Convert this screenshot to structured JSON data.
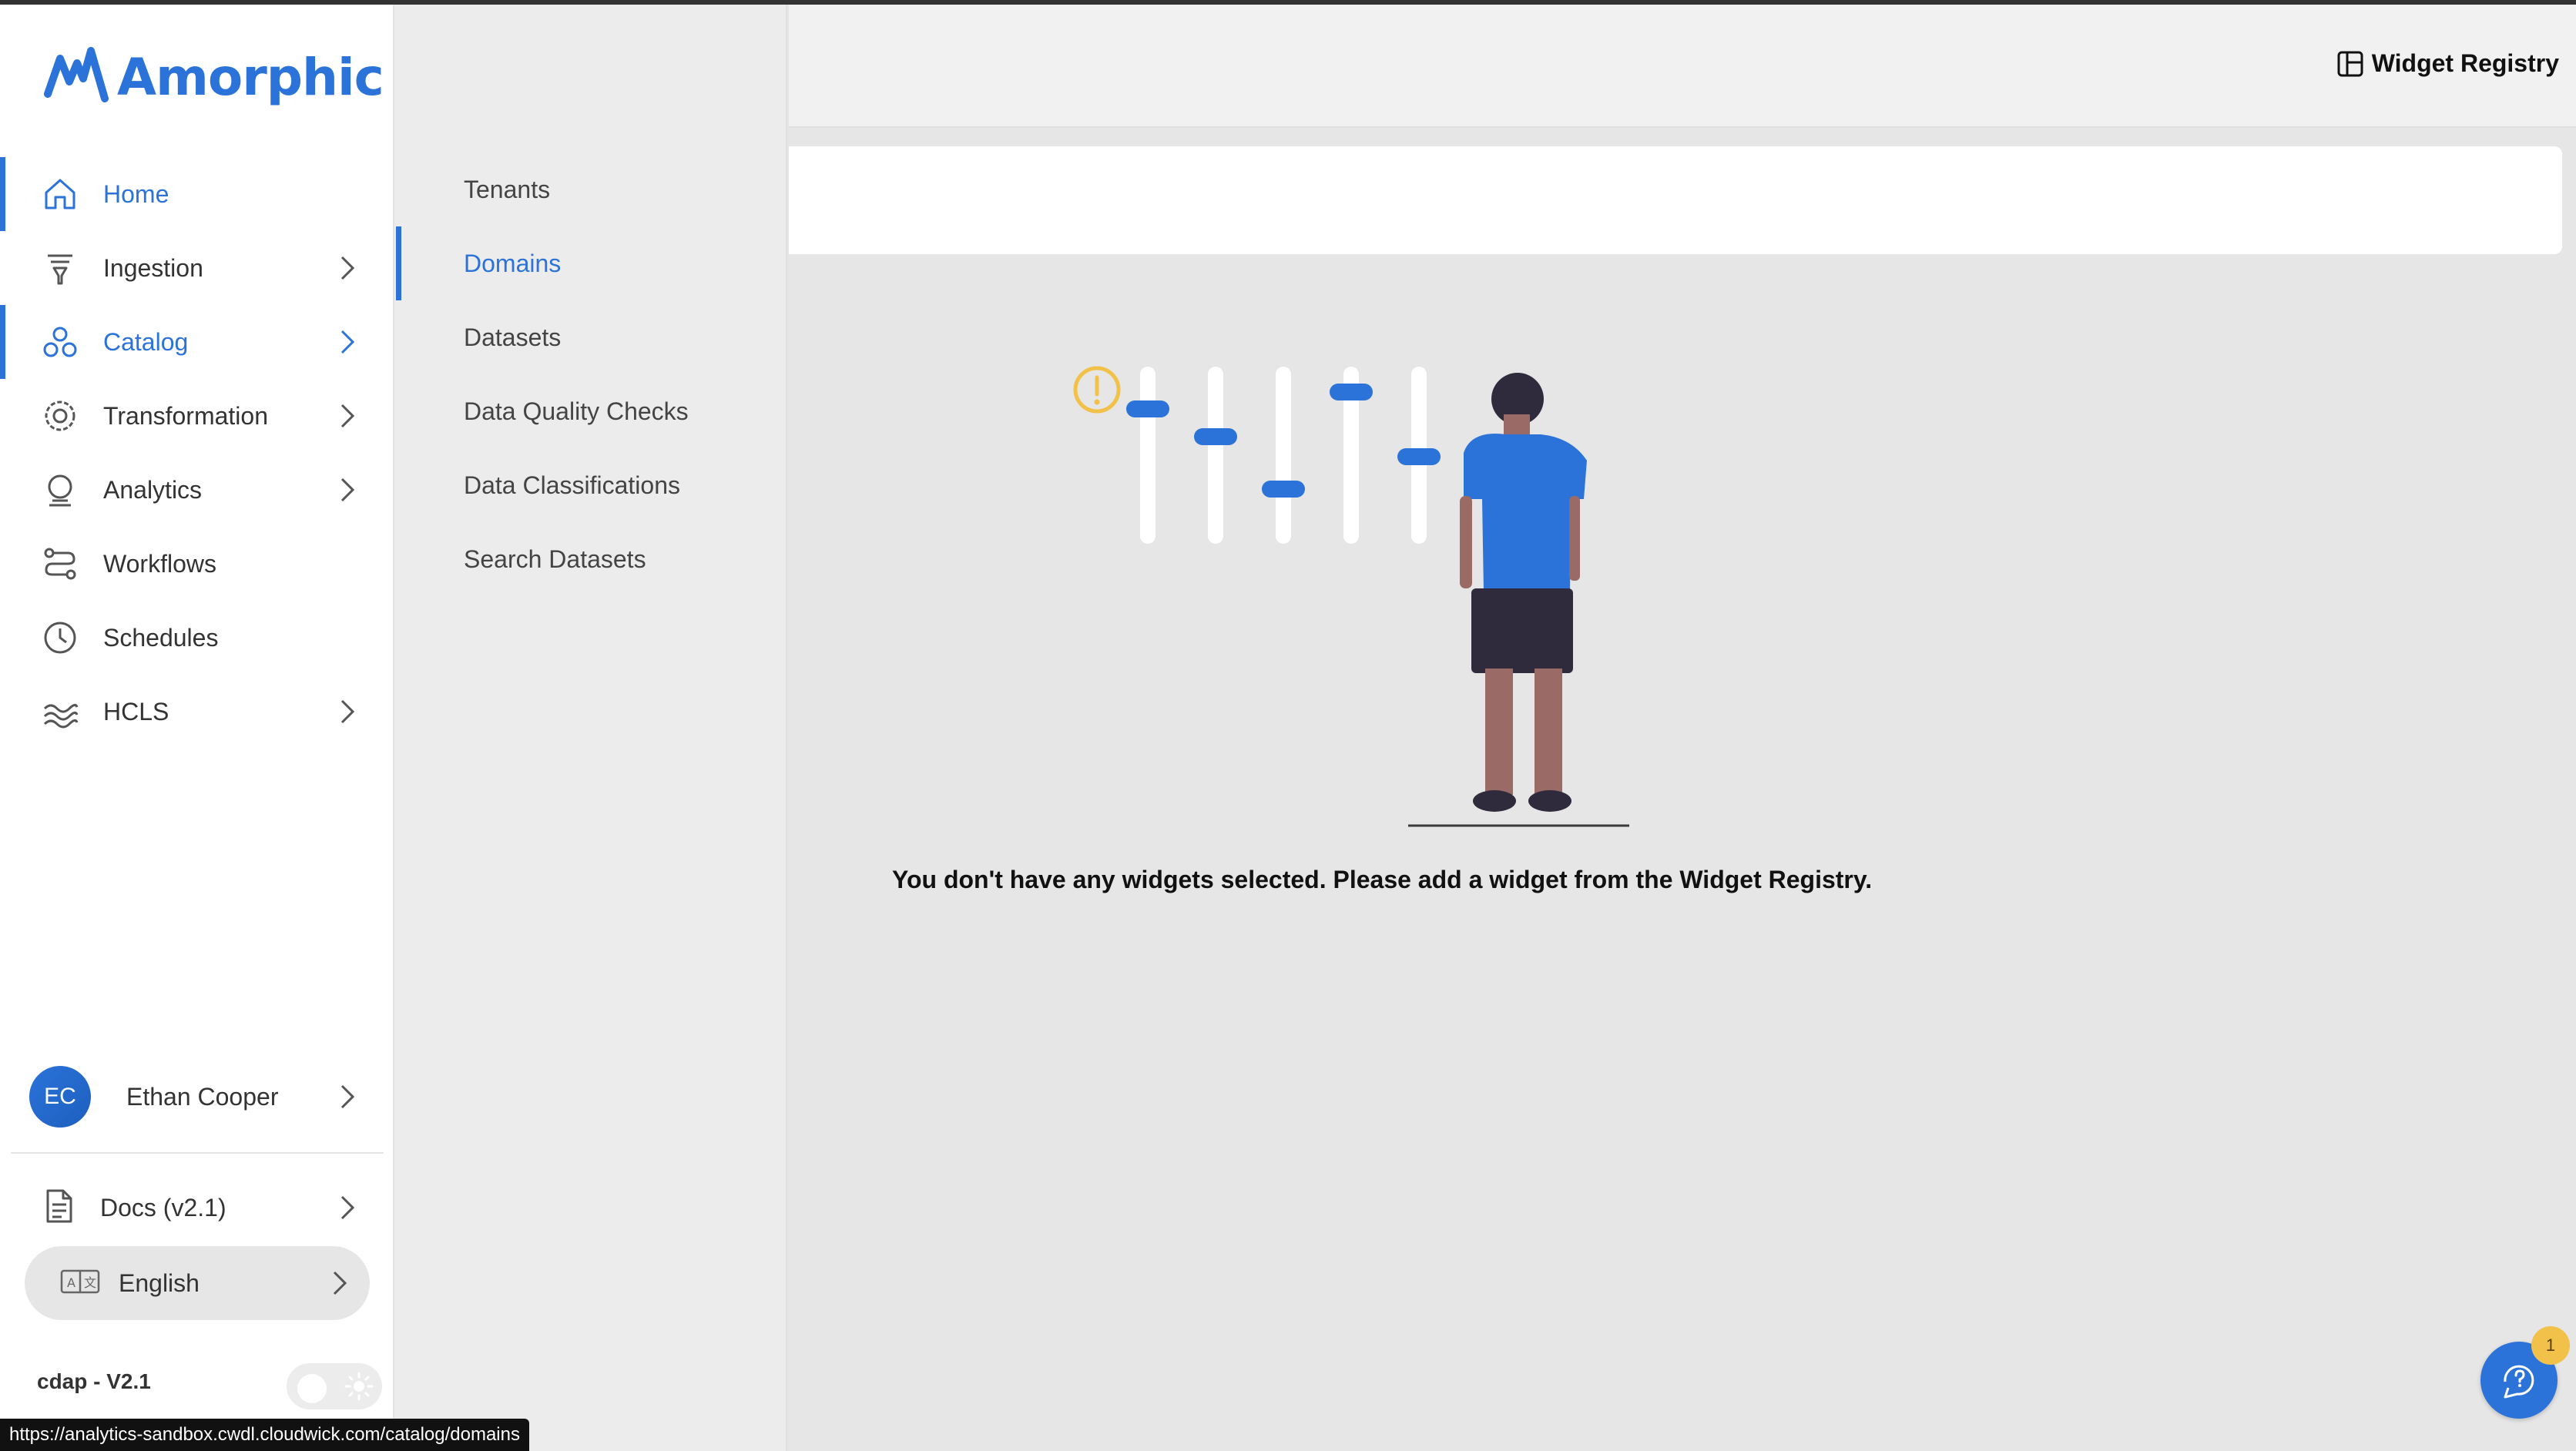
{
  "brand": {
    "name": "Amorphic",
    "color": "#2b73d9"
  },
  "sidebar": {
    "items": [
      {
        "label": "Home",
        "icon": "home-icon",
        "active": true,
        "has_children": false
      },
      {
        "label": "Ingestion",
        "icon": "ingestion-icon",
        "active": false,
        "has_children": true
      },
      {
        "label": "Catalog",
        "icon": "catalog-icon",
        "active": true,
        "has_children": true
      },
      {
        "label": "Transformation",
        "icon": "transformation-icon",
        "active": false,
        "has_children": true
      },
      {
        "label": "Analytics",
        "icon": "analytics-icon",
        "active": false,
        "has_children": true
      },
      {
        "label": "Workflows",
        "icon": "workflows-icon",
        "active": false,
        "has_children": false
      },
      {
        "label": "Schedules",
        "icon": "schedules-icon",
        "active": false,
        "has_children": false
      },
      {
        "label": "HCLS",
        "icon": "hcls-icon",
        "active": false,
        "has_children": true
      }
    ],
    "user": {
      "initials": "EC",
      "name": "Ethan Cooper"
    },
    "docs": {
      "label": "Docs (v2.1)",
      "icon": "document-icon"
    },
    "language": {
      "label": "English",
      "icon": "translate-icon"
    },
    "version": "cdap - V2.1",
    "theme_toggle": {
      "icon": "sun-icon",
      "mode": "light"
    }
  },
  "catalog_menu": {
    "items": [
      {
        "label": "Tenants",
        "active": false
      },
      {
        "label": "Domains",
        "active": true
      },
      {
        "label": "Datasets",
        "active": false
      },
      {
        "label": "Data Quality Checks",
        "active": false
      },
      {
        "label": "Data Classifications",
        "active": false
      },
      {
        "label": "Search Datasets",
        "active": false
      }
    ]
  },
  "header": {
    "widget_registry_label": "Widget Registry",
    "widget_registry_icon": "layout-icon"
  },
  "main": {
    "empty_message": "You don't have any widgets selected. Please add a widget from the Widget Registry.",
    "illustration": "empty-widgets-illustration"
  },
  "help": {
    "icon": "chat-help-icon",
    "badge_count": "1"
  },
  "status_bar": {
    "url": "https://analytics-sandbox.cwdl.cloudwick.com/catalog/domains"
  },
  "colors": {
    "accent": "#2b73d9",
    "badge": "#f2c14a",
    "warning": "#f2c14a"
  }
}
